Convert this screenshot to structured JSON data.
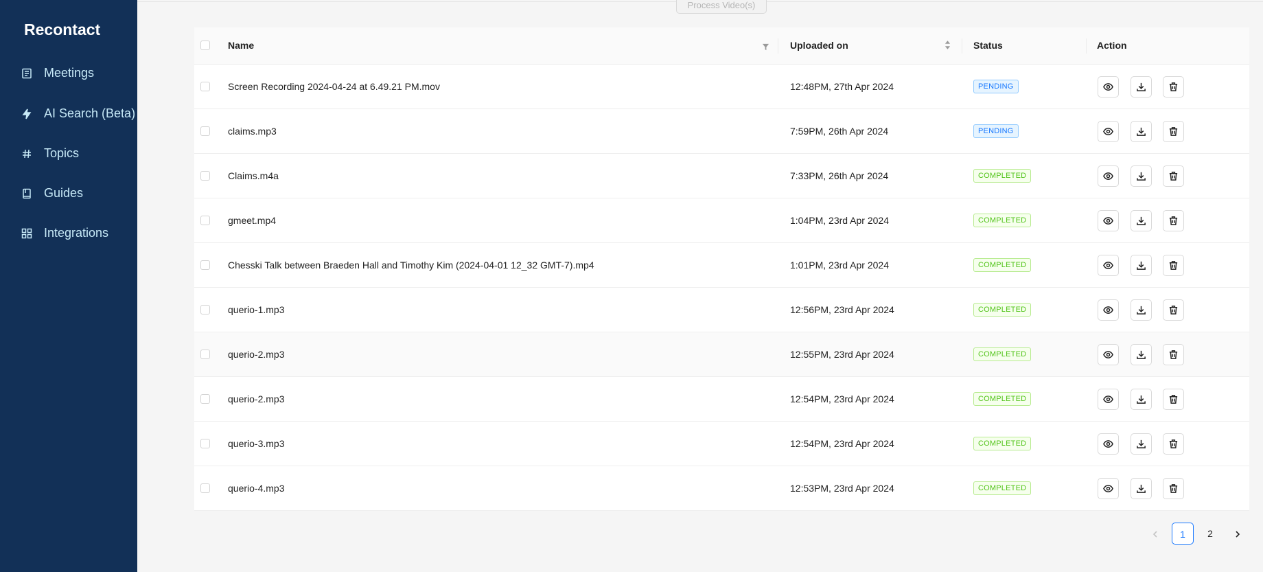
{
  "app": {
    "brand": "Recontact"
  },
  "sidebar": {
    "items": [
      {
        "label": "Meetings",
        "icon": "meetings-icon"
      },
      {
        "label": "AI Search (Beta)",
        "icon": "lightning-icon"
      },
      {
        "label": "Topics",
        "icon": "hash-icon"
      },
      {
        "label": "Guides",
        "icon": "book-icon"
      },
      {
        "label": "Integrations",
        "icon": "grid-icon"
      }
    ]
  },
  "toolbar": {
    "process_label": "Process Video(s)"
  },
  "table": {
    "columns": {
      "name": "Name",
      "uploaded": "Uploaded on",
      "status": "Status",
      "action": "Action"
    },
    "rows": [
      {
        "name": "Screen Recording 2024-04-24 at 6.49.21 PM.mov",
        "uploaded": "12:48PM, 27th Apr 2024",
        "status": "PENDING"
      },
      {
        "name": "claims.mp3",
        "uploaded": "7:59PM, 26th Apr 2024",
        "status": "PENDING"
      },
      {
        "name": "Claims.m4a",
        "uploaded": "7:33PM, 26th Apr 2024",
        "status": "COMPLETED"
      },
      {
        "name": "gmeet.mp4",
        "uploaded": "1:04PM, 23rd Apr 2024",
        "status": "COMPLETED"
      },
      {
        "name": "Chesski Talk between Braeden Hall and Timothy Kim (2024-04-01 12_32 GMT-7).mp4",
        "uploaded": "1:01PM, 23rd Apr 2024",
        "status": "COMPLETED"
      },
      {
        "name": "querio-1.mp3",
        "uploaded": "12:56PM, 23rd Apr 2024",
        "status": "COMPLETED"
      },
      {
        "name": "querio-2.mp3",
        "uploaded": "12:55PM, 23rd Apr 2024",
        "status": "COMPLETED"
      },
      {
        "name": "querio-2.mp3",
        "uploaded": "12:54PM, 23rd Apr 2024",
        "status": "COMPLETED"
      },
      {
        "name": "querio-3.mp3",
        "uploaded": "12:54PM, 23rd Apr 2024",
        "status": "COMPLETED"
      },
      {
        "name": "querio-4.mp3",
        "uploaded": "12:53PM, 23rd Apr 2024",
        "status": "COMPLETED"
      }
    ]
  },
  "pagination": {
    "pages": [
      "1",
      "2"
    ],
    "current": "1"
  },
  "colors": {
    "sidebar_bg": "#123057",
    "accent": "#1677ff",
    "pending": "#1677ff",
    "completed": "#52c41a"
  }
}
